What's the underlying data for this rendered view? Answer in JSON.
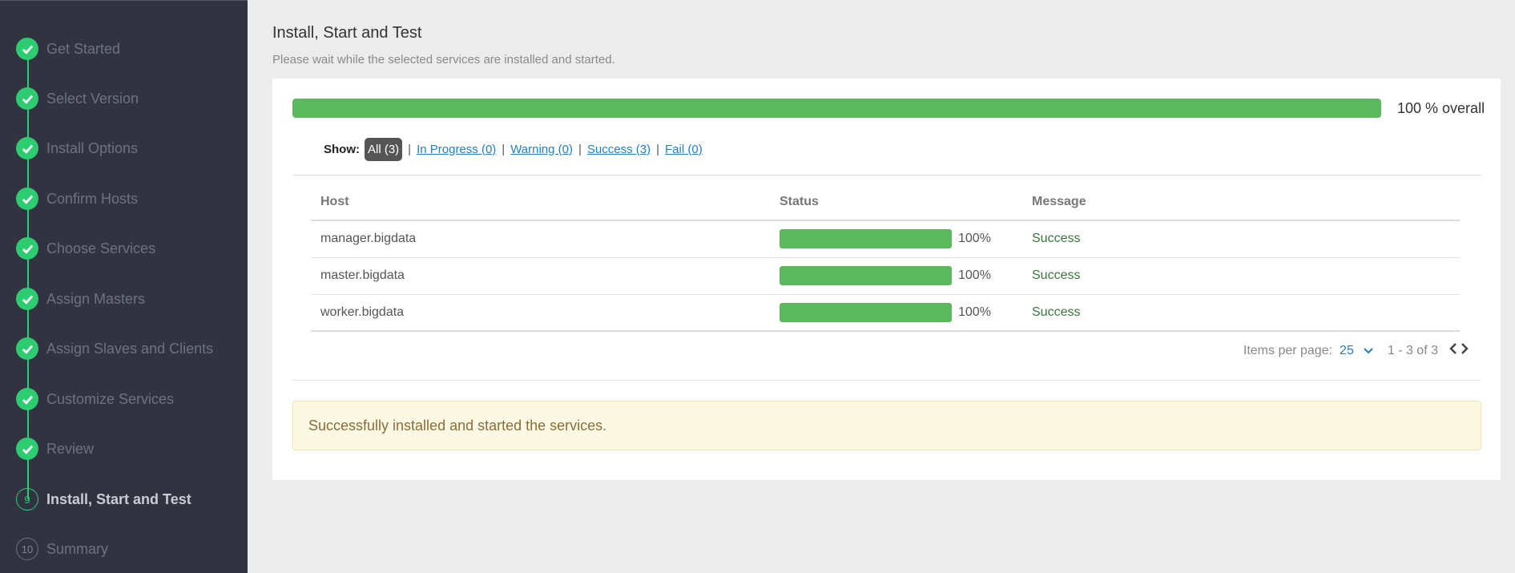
{
  "sidebar": {
    "steps": [
      {
        "label": "Get Started",
        "state": "done"
      },
      {
        "label": "Select Version",
        "state": "done"
      },
      {
        "label": "Install Options",
        "state": "done"
      },
      {
        "label": "Confirm Hosts",
        "state": "done"
      },
      {
        "label": "Choose Services",
        "state": "done"
      },
      {
        "label": "Assign Masters",
        "state": "done"
      },
      {
        "label": "Assign Slaves and Clients",
        "state": "done"
      },
      {
        "label": "Customize Services",
        "state": "done"
      },
      {
        "label": "Review",
        "state": "done"
      },
      {
        "label": "Install, Start and Test",
        "state": "current",
        "number": "9"
      },
      {
        "label": "Summary",
        "state": "pending",
        "number": "10"
      }
    ],
    "icon": "check-icon"
  },
  "main": {
    "title": "Install, Start and Test",
    "subtitle": "Please wait while the selected services are installed and started.",
    "overall_progress": 100,
    "overall_label": "100 % overall",
    "filter": {
      "show_label": "Show:",
      "all": "All (3)",
      "in_progress": "In Progress (0)",
      "warning": "Warning (0)",
      "success": "Success (3)",
      "fail": "Fail (0)",
      "separator": "|"
    },
    "table": {
      "headers": [
        "Host",
        "Status",
        "Message"
      ],
      "rows": [
        {
          "host": "manager.bigdata",
          "progress": 100,
          "pct": "100%",
          "message": "Success"
        },
        {
          "host": "master.bigdata",
          "progress": 100,
          "pct": "100%",
          "message": "Success"
        },
        {
          "host": "worker.bigdata",
          "progress": 100,
          "pct": "100%",
          "message": "Success"
        }
      ]
    },
    "pager": {
      "items_label": "Items per page:",
      "items_value": "25",
      "range": "1 - 3 of 3"
    },
    "alert": "Successfully installed and started the services."
  },
  "colors": {
    "sidebar_bg": "#313440",
    "step_done": "#2ecc71",
    "progress": "#5cb85c",
    "link": "#1f7fc1",
    "success_text": "#3c763d",
    "alert_bg": "#fcf8e3"
  }
}
